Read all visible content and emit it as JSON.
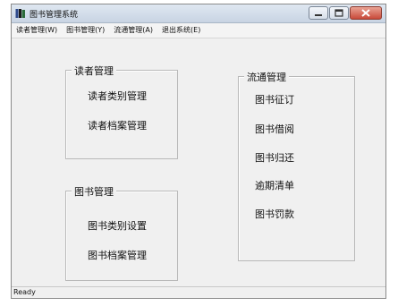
{
  "window": {
    "title": "图书管理系统",
    "icon": "books-icon"
  },
  "menubar": {
    "items": [
      {
        "label": "读者管理(W)"
      },
      {
        "label": "图书管理(Y)"
      },
      {
        "label": "流通管理(A)"
      },
      {
        "label": "退出系统(E)"
      }
    ]
  },
  "groups": {
    "reader": {
      "title": "读者管理",
      "items": [
        {
          "label": "读者类别管理"
        },
        {
          "label": "读者档案管理"
        }
      ]
    },
    "book": {
      "title": "图书管理",
      "items": [
        {
          "label": "图书类别设置"
        },
        {
          "label": "图书档案管理"
        }
      ]
    },
    "circulation": {
      "title": "流通管理",
      "items": [
        {
          "label": "图书征订"
        },
        {
          "label": "图书借阅"
        },
        {
          "label": "图书归还"
        },
        {
          "label": "逾期清单"
        },
        {
          "label": "图书罚款"
        }
      ]
    }
  },
  "statusbar": {
    "text": "Ready"
  },
  "colors": {
    "titlebar": "#c8d4e3",
    "close_button": "#c94a3a",
    "background": "#f0f0f0"
  }
}
